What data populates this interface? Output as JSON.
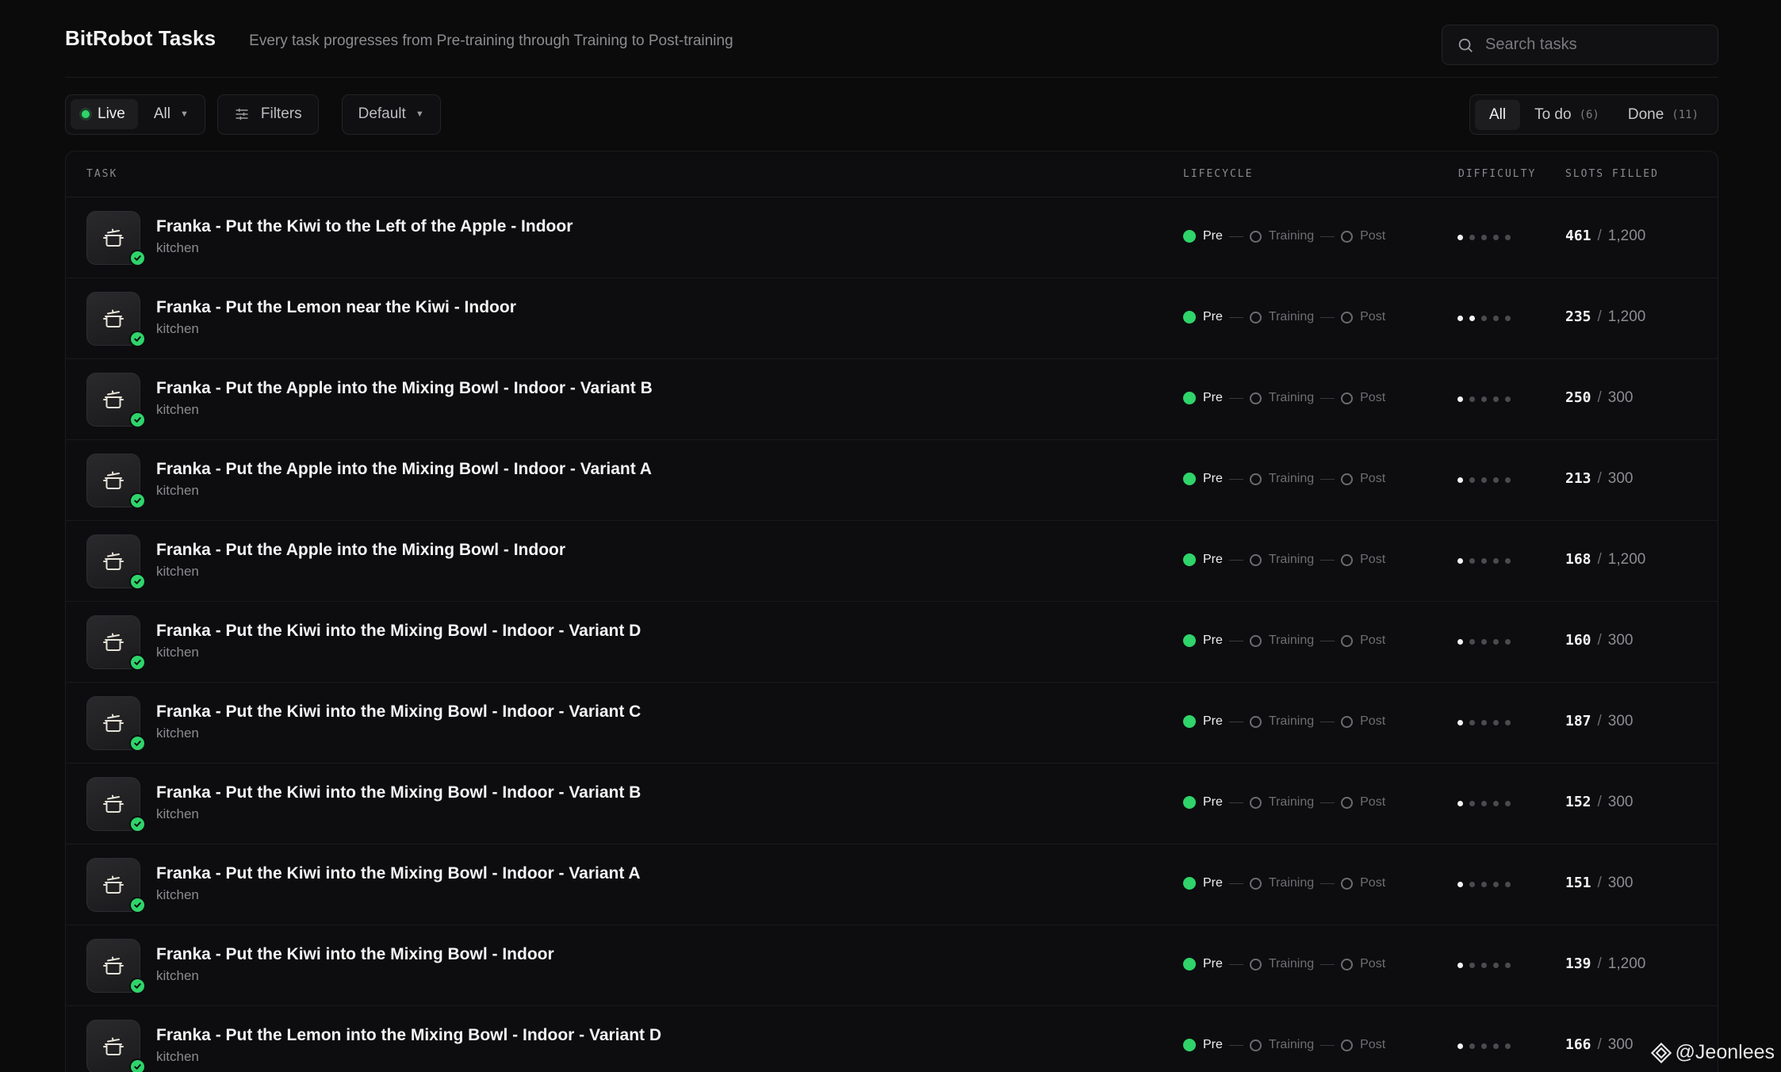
{
  "header": {
    "title": "BitRobot Tasks",
    "subtitle": "Every task progresses from Pre-training through Training to Post-training",
    "search_placeholder": "Search tasks"
  },
  "toolbar": {
    "live_label": "Live",
    "scope_label": "All",
    "filters_label": "Filters",
    "sort_label": "Default",
    "tabs": [
      {
        "label": "All",
        "count": ""
      },
      {
        "label": "To do",
        "count": "(6)"
      },
      {
        "label": "Done",
        "count": "(11)"
      }
    ]
  },
  "columns": {
    "task": "TASK",
    "lifecycle": "LIFECYCLE",
    "difficulty": "DIFFICULTY",
    "slots": "SLOTS FILLED"
  },
  "lifecycle_labels": {
    "pre": "Pre",
    "training": "Training",
    "post": "Post"
  },
  "slot_separator": "/",
  "rows": [
    {
      "title": "Franka - Put the Kiwi to the Left of the Apple - Indoor",
      "category": "kitchen",
      "difficulty": 1,
      "filled": "461",
      "total": "1,200"
    },
    {
      "title": "Franka - Put the Lemon near the Kiwi - Indoor",
      "category": "kitchen",
      "difficulty": 2,
      "filled": "235",
      "total": "1,200"
    },
    {
      "title": "Franka - Put the Apple into the Mixing Bowl - Indoor - Variant B",
      "category": "kitchen",
      "difficulty": 1,
      "filled": "250",
      "total": "300"
    },
    {
      "title": "Franka - Put the Apple into the Mixing Bowl - Indoor - Variant A",
      "category": "kitchen",
      "difficulty": 1,
      "filled": "213",
      "total": "300"
    },
    {
      "title": "Franka - Put the Apple into the Mixing Bowl - Indoor",
      "category": "kitchen",
      "difficulty": 1,
      "filled": "168",
      "total": "1,200"
    },
    {
      "title": "Franka - Put the Kiwi into the Mixing Bowl - Indoor - Variant D",
      "category": "kitchen",
      "difficulty": 1,
      "filled": "160",
      "total": "300"
    },
    {
      "title": "Franka - Put the Kiwi into the Mixing Bowl - Indoor - Variant C",
      "category": "kitchen",
      "difficulty": 1,
      "filled": "187",
      "total": "300"
    },
    {
      "title": "Franka - Put the Kiwi into the Mixing Bowl - Indoor - Variant B",
      "category": "kitchen",
      "difficulty": 1,
      "filled": "152",
      "total": "300"
    },
    {
      "title": "Franka - Put the Kiwi into the Mixing Bowl - Indoor - Variant A",
      "category": "kitchen",
      "difficulty": 1,
      "filled": "151",
      "total": "300"
    },
    {
      "title": "Franka - Put the Kiwi into the Mixing Bowl - Indoor",
      "category": "kitchen",
      "difficulty": 1,
      "filled": "139",
      "total": "1,200"
    },
    {
      "title": "Franka - Put the Lemon into the Mixing Bowl - Indoor - Variant D",
      "category": "kitchen",
      "difficulty": 1,
      "filled": "166",
      "total": "300"
    }
  ],
  "task_icon": "cooking-pot-icon",
  "status_icon": "check-circle-icon",
  "accent_color": "#2fd46a",
  "watermark": "@Jeonlees"
}
